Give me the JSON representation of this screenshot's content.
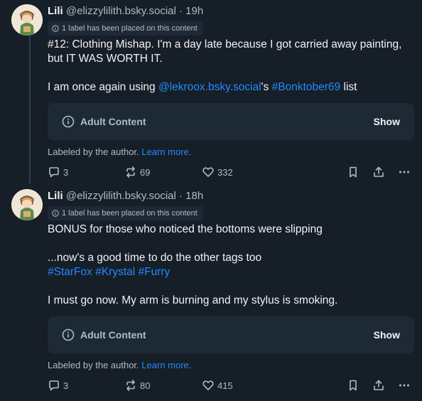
{
  "posts": [
    {
      "name": "Lili",
      "handle": "@elizzylilith.bsky.social · 19h",
      "label_notice": "1 label has been placed on this content",
      "text_lines": [
        "#12: Clothing Mishap. I'm a day late because I got carried away painting,",
        "but IT WAS WORTH IT."
      ],
      "list_pre": "I am once again using ",
      "list_link": "@lekroox.bsky.social",
      "list_mid": "'s ",
      "list_tag": "#Bonktober69",
      "list_post": " list",
      "warning_label": "Adult Content",
      "warning_show": "Show",
      "labeled_text": "Labeled by the author.",
      "learn_more": "Learn more.",
      "replies": "3",
      "reposts": "69",
      "likes": "332"
    },
    {
      "name": "Lili",
      "handle": "@elizzylilith.bsky.social · 18h",
      "label_notice": "1 label has been placed on this content",
      "line1": "BONUS for those who noticed the bottoms were slipping",
      "line2": "...now's a good time to do the other tags too",
      "tags": [
        "#StarFox",
        "#Krystal",
        "#Furry"
      ],
      "line3": "I must go now. My arm is burning and my stylus is smoking.",
      "warning_label": "Adult Content",
      "warning_show": "Show",
      "labeled_text": "Labeled by the author.",
      "learn_more": "Learn more.",
      "replies": "3",
      "reposts": "80",
      "likes": "415"
    }
  ],
  "colors": {
    "background": "#161e27",
    "link": "#208bfe",
    "muted": "#aebbc9",
    "card": "#1e2936"
  },
  "icons": [
    "avatar",
    "info-icon",
    "alert-circle-icon",
    "reply-icon",
    "repost-icon",
    "heart-icon",
    "bookmark-icon",
    "share-icon",
    "more-icon"
  ]
}
